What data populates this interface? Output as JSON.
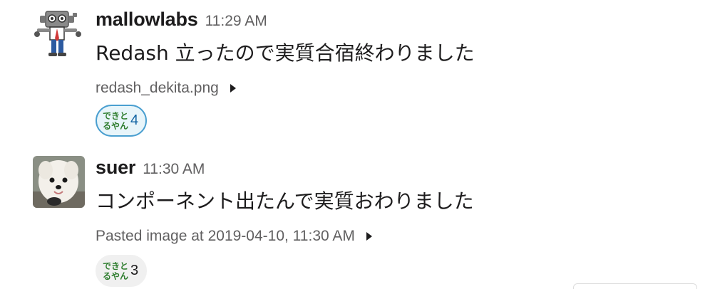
{
  "messages": [
    {
      "user": "mallowlabs",
      "avatar_icon": "robot-avatar",
      "time": "11:29 AM",
      "text": "Redash 立ったので実質合宿終わりました",
      "attachment": "redash_dekita.png",
      "reaction": {
        "emoji_line1": "できと",
        "emoji_line2": "るやん",
        "count": "4",
        "reacted_by_me": true
      }
    },
    {
      "user": "suer",
      "avatar_icon": "dog-avatar",
      "time": "11:30 AM",
      "text": "コンポーネント出たんで実質おわりました",
      "attachment": "Pasted image at 2019-04-10, 11:30 AM",
      "reaction": {
        "emoji_line1": "できと",
        "emoji_line2": "るやん",
        "count": "3",
        "reacted_by_me": false
      }
    }
  ],
  "colors": {
    "username": "#1d1c1d",
    "timestamp": "#616061",
    "reaction_active_bg": "#e8f5fa",
    "reaction_active_border": "#4a9fd0",
    "reaction_bg": "#f0f0f0",
    "emoji_text": "#2e7d2e"
  }
}
